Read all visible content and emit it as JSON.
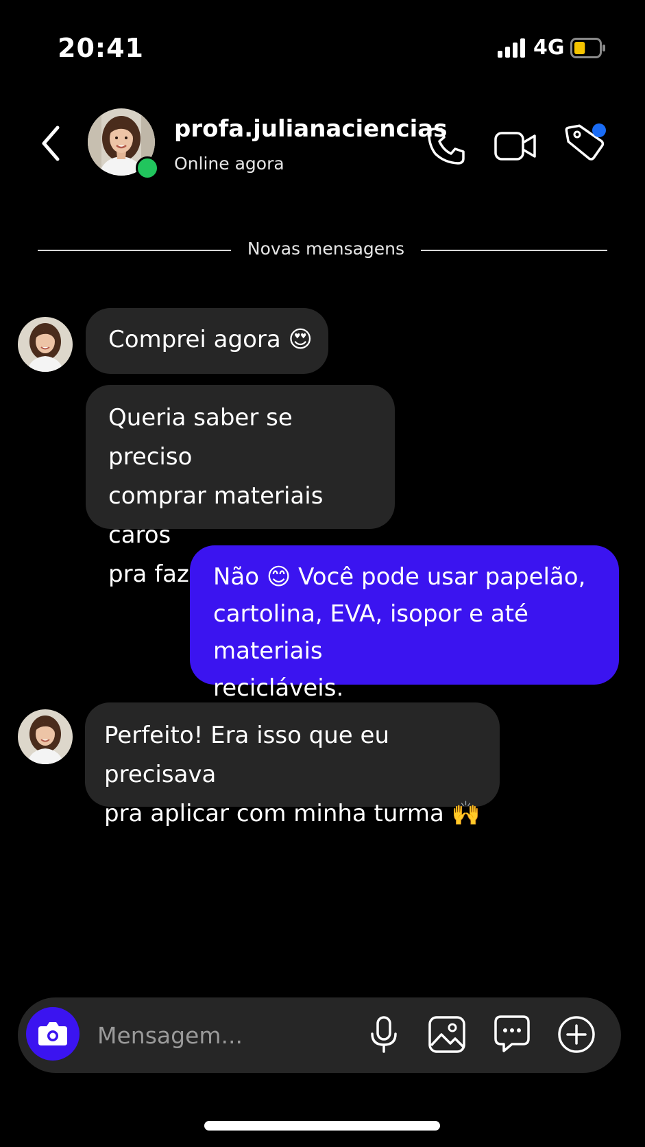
{
  "status_bar": {
    "time": "20:41",
    "network": "4G",
    "battery_level": 0.45,
    "battery_color": "#f5c400"
  },
  "header": {
    "back_icon": "chevron-left-icon",
    "contact_name": "profa.julianaciencias",
    "contact_status": "Online agora",
    "online_color": "#21c55d",
    "actions": [
      "phone-icon",
      "video-camera-icon",
      "tag-icon"
    ],
    "notification_dot_color": "#1a6cf5"
  },
  "divider": {
    "label": "Novas mensagens"
  },
  "messages": [
    {
      "direction": "incoming",
      "text": "Comprei agora",
      "emoji": "😍"
    },
    {
      "direction": "incoming",
      "lines": [
        "Queria saber se preciso",
        "comprar materiais caros",
        "pra fazer os projetos"
      ]
    },
    {
      "direction": "outgoing",
      "line1_start": "Não",
      "emoji": "😊",
      "line1_end": "Você pode usar papelão,",
      "lines_rest": [
        "cartolina, EVA, isopor e até materiais",
        "recicláveis."
      ]
    },
    {
      "direction": "incoming",
      "lines": [
        "Perfeito! Era isso que eu precisava",
        "pra aplicar com minha turma"
      ],
      "emoji": "🙌"
    }
  ],
  "composer": {
    "placeholder": "Mensagem...",
    "icons": [
      "camera-icon",
      "microphone-icon",
      "image-icon",
      "sticker-icon",
      "plus-circle-icon"
    ]
  },
  "colors": {
    "background": "#000000",
    "incoming_bubble": "#262626",
    "outgoing_bubble": "#3b14f0",
    "accent": "#3b14f0"
  }
}
